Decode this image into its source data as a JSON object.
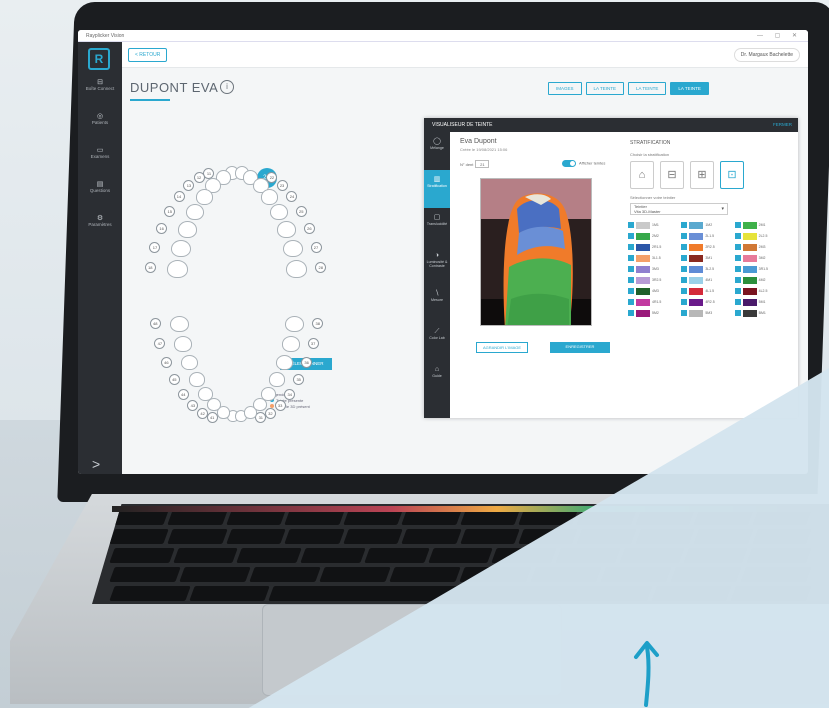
{
  "app": {
    "window_title": "Rayplicker Vision",
    "back_label": "< RETOUR",
    "user_label": "Dr. Margaux Bachelette",
    "patient_name": "DUPONT EVA",
    "info_icon": "i",
    "actions": [
      "IMAGES",
      "LA TEINTE",
      "LA TEINTE",
      "LA TEINTE"
    ]
  },
  "sidebar": {
    "logo": "R",
    "items": [
      {
        "icon": "inbox-icon",
        "label": "Boîte Connect"
      },
      {
        "icon": "patients-icon",
        "label": "Patients"
      },
      {
        "icon": "cases-icon",
        "label": "Examens"
      },
      {
        "icon": "support-icon",
        "label": "Questions"
      },
      {
        "icon": "settings-icon",
        "label": "Paramètres"
      }
    ],
    "expand": ">"
  },
  "teeth": {
    "selected": "21",
    "select_button": "SÉLECTIONNER",
    "legend_title": "Légende",
    "legend": [
      "Teinte présente",
      "Modèle 3D présent"
    ]
  },
  "viewer": {
    "title": "VISUALISEUR DE TEINTE",
    "close": "FERMER",
    "tools": [
      "Mélange",
      "Stratification",
      "Translucidité",
      "Luminosité & Contraste",
      "Mesure",
      "Color Lab",
      "Guide"
    ],
    "patient": "Eva Dupont",
    "created": "Créée le 19/08/2021 15:06",
    "tooth_label": "N° dent",
    "tooth_value": "21",
    "toggle_label": "Afficher teintes",
    "btn_outline": "AGRANDIR L'IMAGE",
    "btn_fill": "ENREGISTRER"
  },
  "stratification": {
    "title": "STRATIFICATION",
    "choose_label": "Choisir la stratification",
    "library_label": "Sélectionner votre teintier",
    "library_value": "Teintier\nVita 3D-Master",
    "shades": [
      {
        "name": "1M1",
        "color": "#c9c9c9"
      },
      {
        "name": "1M2",
        "color": "#5aa9cf"
      },
      {
        "name": "2M1",
        "color": "#3fb14a"
      },
      {
        "name": "2M2",
        "color": "#36a84a"
      },
      {
        "name": "2L1.5",
        "color": "#6a8fd6"
      },
      {
        "name": "2L2.5",
        "color": "#e6e33a"
      },
      {
        "name": "2R1.5",
        "color": "#2b56a8"
      },
      {
        "name": "2R2.5",
        "color": "#f07b2a"
      },
      {
        "name": "2M3",
        "color": "#d07836"
      },
      {
        "name": "3L1.5",
        "color": "#f4a06a"
      },
      {
        "name": "3M1",
        "color": "#8a2a20"
      },
      {
        "name": "3M2",
        "color": "#e77a9a"
      },
      {
        "name": "3M3",
        "color": "#8f7fcf"
      },
      {
        "name": "3L2.5",
        "color": "#5e8bd6"
      },
      {
        "name": "3R1.5",
        "color": "#4a9ad4"
      },
      {
        "name": "3R2.5",
        "color": "#b79bd6"
      },
      {
        "name": "4M1",
        "color": "#9ad0e8"
      },
      {
        "name": "4M2",
        "color": "#2b8f3c"
      },
      {
        "name": "4M3",
        "color": "#1f5f2a"
      },
      {
        "name": "4L1.5",
        "color": "#d42a3a"
      },
      {
        "name": "4L2.5",
        "color": "#7a1420"
      },
      {
        "name": "4R1.5",
        "color": "#c23aa0"
      },
      {
        "name": "4R2.5",
        "color": "#6a1a8a"
      },
      {
        "name": "5M1",
        "color": "#4a1a6a"
      },
      {
        "name": "5M2",
        "color": "#9a1a7a"
      },
      {
        "name": "5M3",
        "color": "#b7b7b7"
      },
      {
        "name": "BM1",
        "color": "#3a3a3a"
      }
    ]
  },
  "colors": {
    "accent": "#2aa8cf",
    "sidebar": "#2b2e33"
  }
}
